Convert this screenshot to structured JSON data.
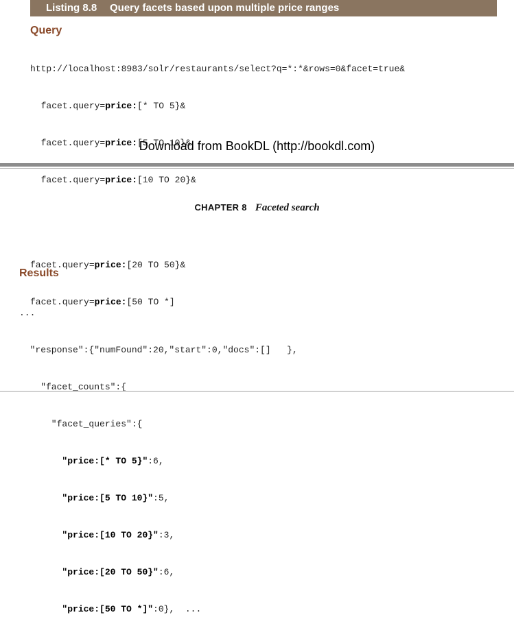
{
  "listing": {
    "number": "Listing 8.8",
    "title": "Query facets based upon multiple price ranges"
  },
  "query": {
    "heading": "Query",
    "lines": [
      {
        "pre": "http://localhost:8983/solr/restaurants/select?q=*:*&rows=0&facet=true&",
        "bold": "",
        "post": ""
      },
      {
        "pre": "  facet.query=",
        "bold": "price:",
        "post": "[* TO 5}&"
      },
      {
        "pre": "  facet.query=",
        "bold": "price:",
        "post": "[5 TO 10}&"
      },
      {
        "pre": "  facet.query=",
        "bold": "price:",
        "post": "[10 TO 20}&"
      }
    ],
    "continued_lines": [
      {
        "pre": "facet.query=",
        "bold": "price:",
        "post": "[20 TO 50}&"
      },
      {
        "pre": "facet.query=",
        "bold": "price:",
        "post": "[50 TO *]"
      }
    ]
  },
  "download_note": "Download from BookDL (http://bookdl.com)",
  "running_head": {
    "chapter_label": "CHAPTER 8",
    "chapter_title": "Faceted search"
  },
  "results": {
    "heading": "Results",
    "lines": [
      {
        "pre": "...",
        "bold": "",
        "post": ""
      },
      {
        "pre": "  \"response\":{\"numFound\":20,\"start\":0,\"docs\":[]   },",
        "bold": "",
        "post": ""
      },
      {
        "pre": "    \"facet_counts\":{",
        "bold": "",
        "post": ""
      },
      {
        "pre": "      \"facet_queries\":{",
        "bold": "",
        "post": ""
      },
      {
        "pre": "        ",
        "bold": "\"price:[* TO 5}\"",
        "post": ":6,"
      },
      {
        "pre": "        ",
        "bold": "\"price:[5 TO 10}\"",
        "post": ":5,"
      },
      {
        "pre": "        ",
        "bold": "\"price:[10 TO 20}\"",
        "post": ":3,"
      },
      {
        "pre": "        ",
        "bold": "\"price:[20 TO 50}\"",
        "post": ":6,"
      },
      {
        "pre": "        ",
        "bold": "\"price:[50 TO *]\"",
        "post": ":0},  ..."
      }
    ]
  }
}
